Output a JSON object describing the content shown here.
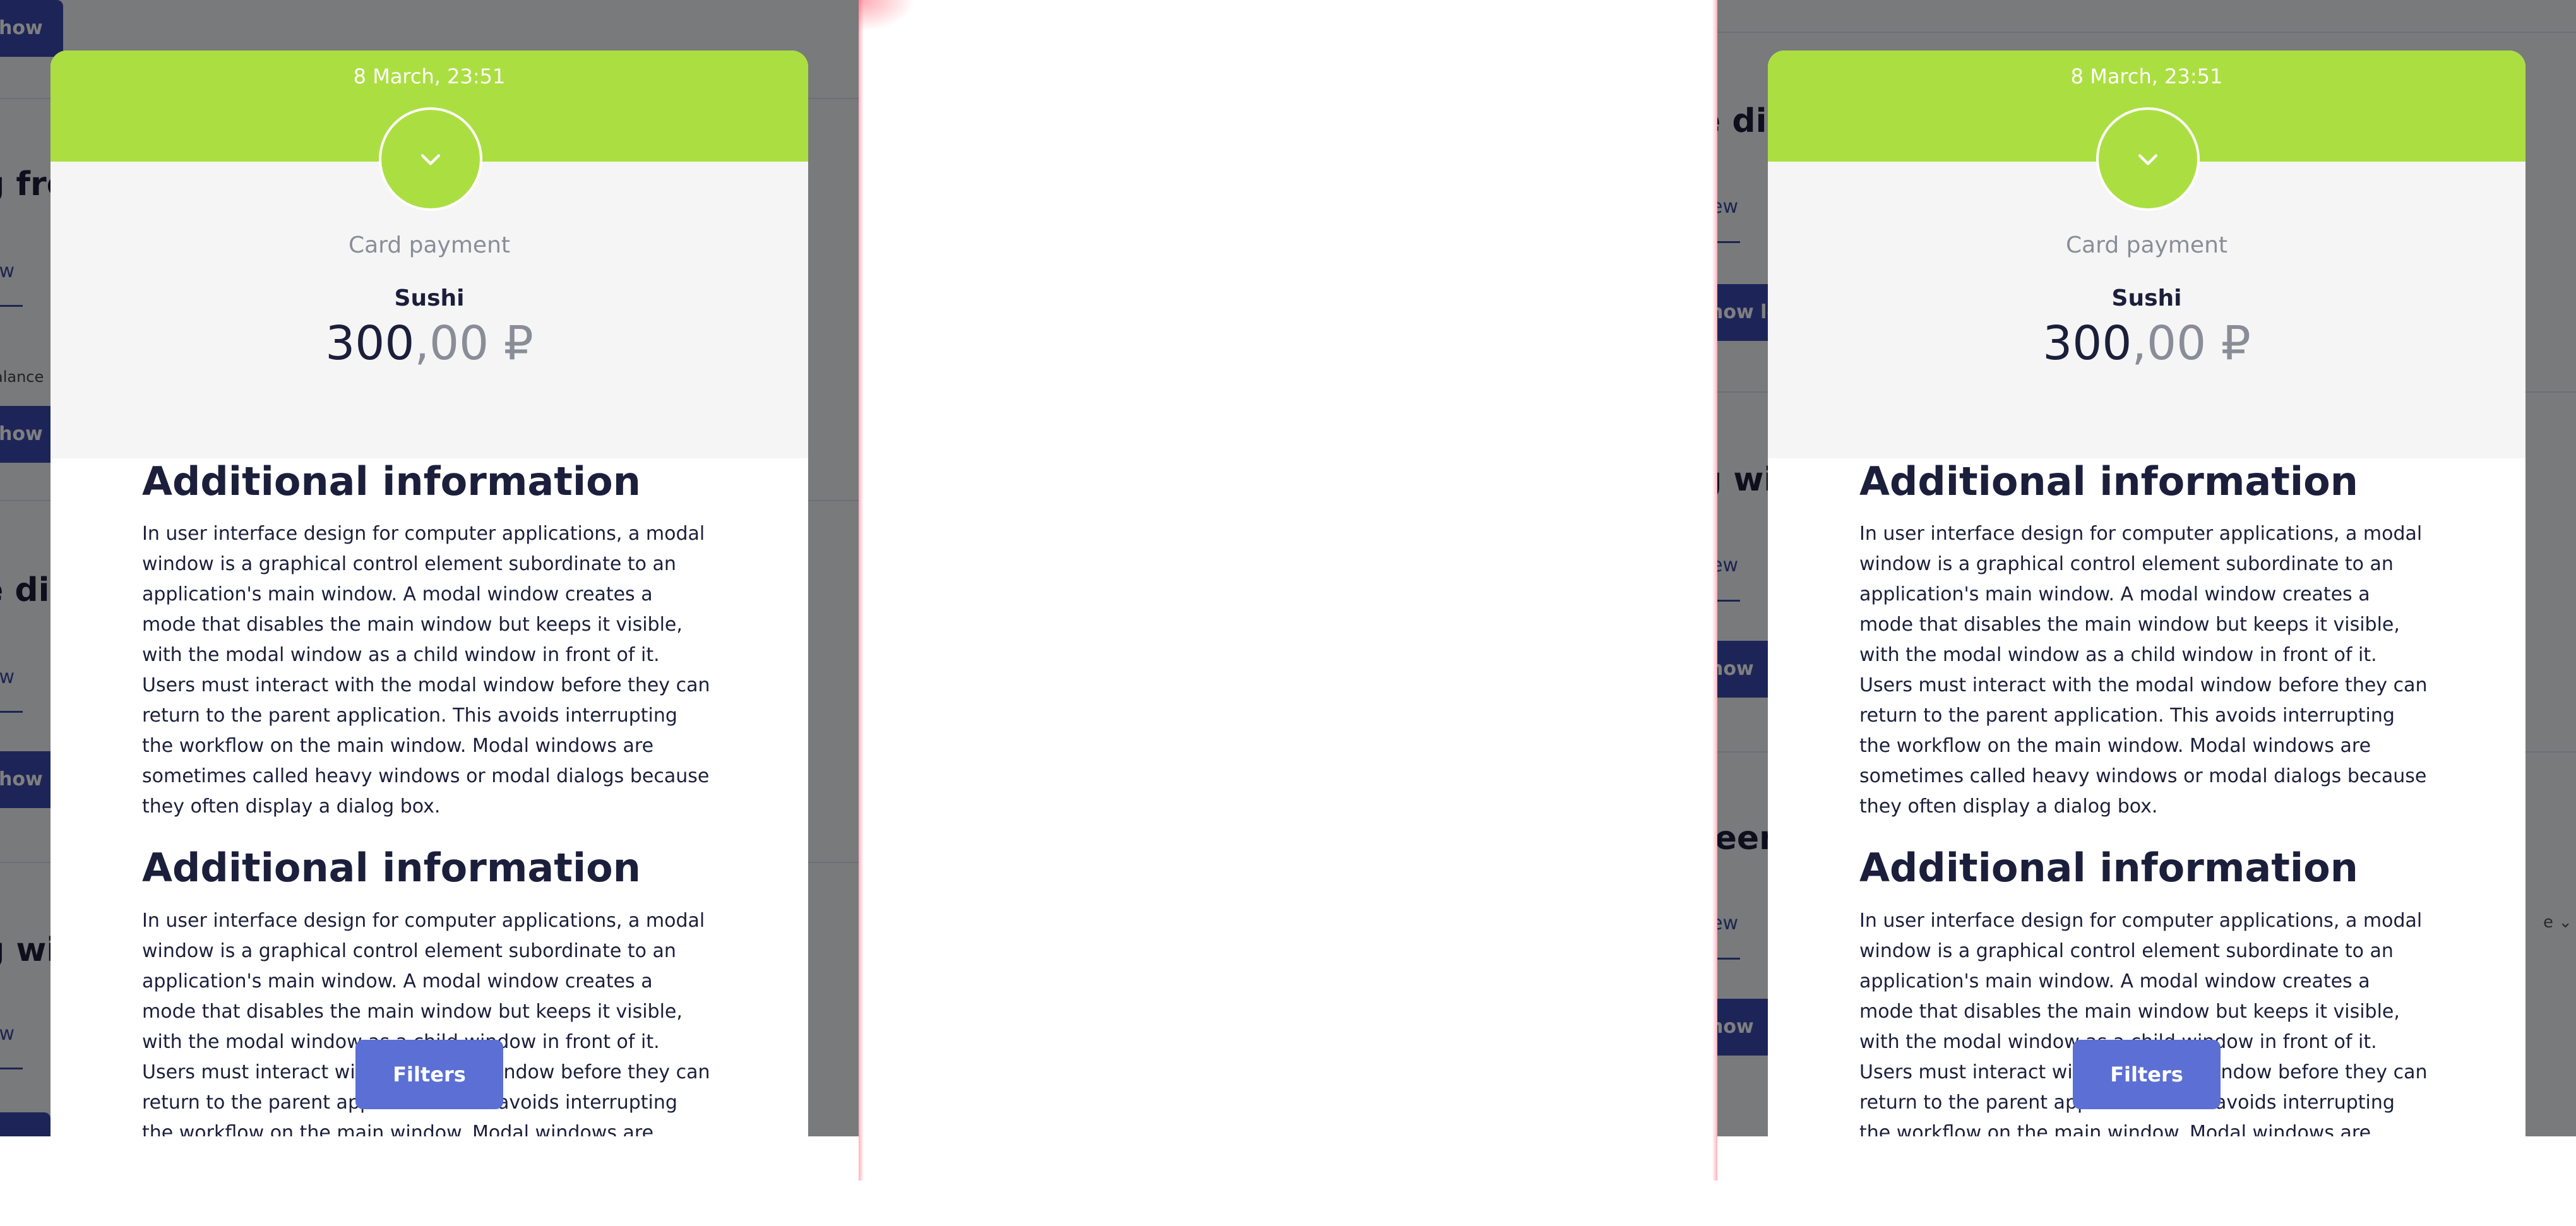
{
  "panels": [
    {
      "backdrop": {
        "btn_top": "how",
        "title_1": "g fro",
        "link_1": "ew",
        "text_balance": "alance",
        "btn_2": "how",
        "title_2": "e dia",
        "link_2": "ew",
        "btn_3": "how lo",
        "title_3": "g wit",
        "link_3": "ew"
      },
      "sheet": {
        "date": "8 March, 23:51",
        "icon": "chevron-down-icon",
        "payment_method": "Card payment",
        "merchant": "Sushi",
        "amount_int": "300",
        "amount_dec": ",00",
        "currency": "₽",
        "sections": [
          {
            "title": "Additional information",
            "body": "In user interface design for computer applications, a modal window is a graphical control element subordinate to an application's main window. A modal window creates a mode that disables the main window but keeps it visible, with the modal window as a child window in front of it. Users must interact with the modal window before they can return to the parent application. This avoids interrupting the workflow on the main window. Modal windows are sometimes called heavy windows or modal dialogs because they often display a dialog box."
          },
          {
            "title": "Additional information",
            "body": "In user interface design for computer applications, a modal window is a graphical control element subordinate to an application's main window. A modal window creates a mode that disables the main window but keeps it visible, with the modal window as a child window in front of it. Users must interact with the modal window before they can return to the parent application. This avoids interrupting the workflow on the main window. Modal windows are sometimes called heavy windows or modal dialogs because they often display a dialog box."
          }
        ]
      },
      "filters_label": "Filters"
    },
    {
      "backdrop": {
        "title_1": "e dia",
        "link_1": "ew",
        "btn_1": "how lo",
        "title_2": "g wit",
        "link_2": "ew",
        "btn_2": "how",
        "title_3": "reen",
        "link_3": "ew",
        "select_hint": "e",
        "btn_3": "how"
      },
      "sheet": {
        "date": "8 March, 23:51",
        "icon": "chevron-down-icon",
        "payment_method": "Card payment",
        "merchant": "Sushi",
        "amount_int": "300",
        "amount_dec": ",00",
        "currency": "₽",
        "sections": [
          {
            "title": "Additional information",
            "body": "In user interface design for computer applications, a modal window is a graphical control element subordinate to an application's main window. A modal window creates a mode that disables the main window but keeps it visible, with the modal window as a child window in front of it. Users must interact with the modal window before they can return to the parent application. This avoids interrupting the workflow on the main window. Modal windows are sometimes called heavy windows or modal dialogs because they often display a dialog box."
          },
          {
            "title": "Additional information",
            "body": "In user interface design for computer applications, a modal window is a graphical control element subordinate to an application's main window. A modal window creates a mode that disables the main window but keeps it visible, with the modal window as a child window in front of it. Users must interact with the modal window before they can return to the parent application. This avoids interrupting the workflow on the main window. Modal windows are sometimes called heavy windows or modal dialogs because they often display a dialog box."
          }
        ]
      },
      "filters_label": "Filters"
    }
  ],
  "colors": {
    "header_green": "#abdf41",
    "sheet_gray": "#f5f5f5",
    "button_blue": "#5b6fd4",
    "text_dark": "#1b1f3b",
    "text_muted": "#8a8d98"
  }
}
